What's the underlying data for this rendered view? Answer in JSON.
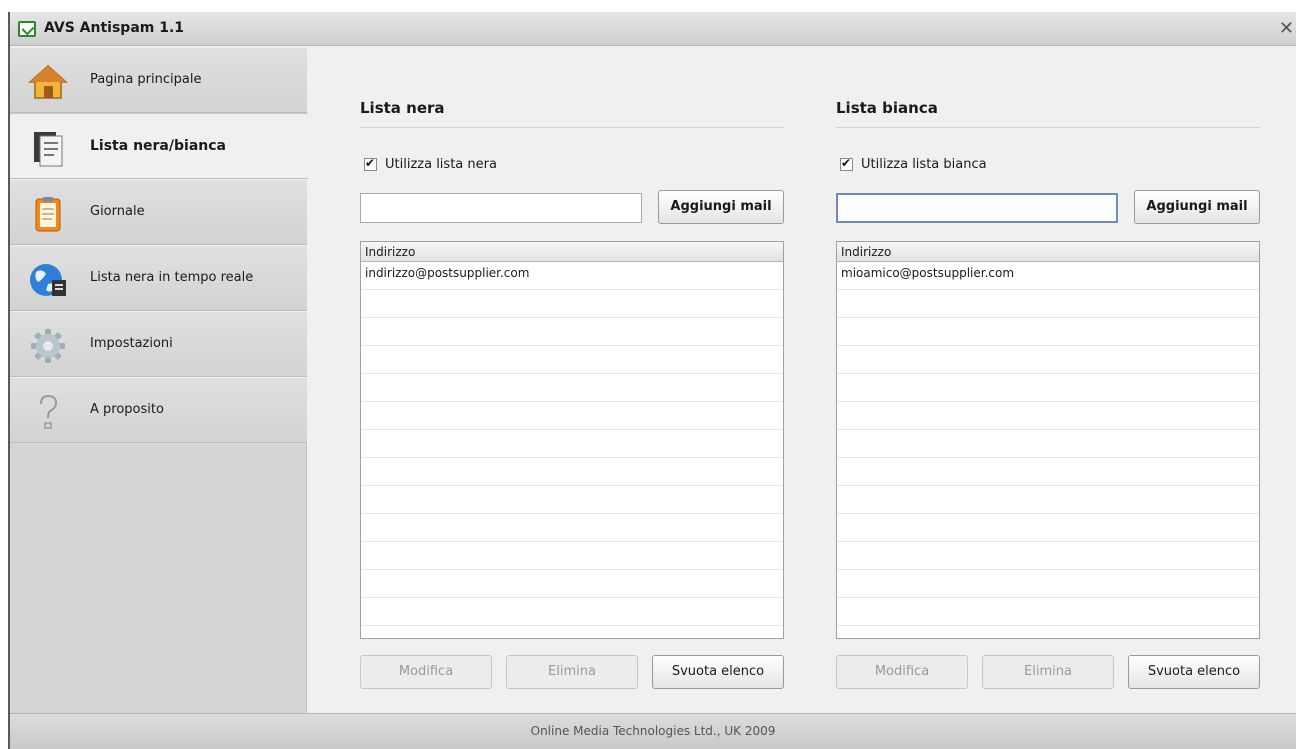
{
  "window": {
    "title": "AVS Antispam 1.1",
    "close_glyph": "✕"
  },
  "sidebar": {
    "items": [
      {
        "label": "Pagina principale",
        "icon": "home-icon"
      },
      {
        "label": "Lista nera/bianca",
        "icon": "document-list-icon"
      },
      {
        "label": "Giornale",
        "icon": "clipboard-icon"
      },
      {
        "label": "Lista nera in tempo reale",
        "icon": "globe-icon"
      },
      {
        "label": "Impostazioni",
        "icon": "gear-icon"
      },
      {
        "label": "A proposito",
        "icon": "question-icon"
      }
    ],
    "active_index": 1
  },
  "blacklist": {
    "title": "Lista nera",
    "checkbox_label": "Utilizza lista nera",
    "checked": true,
    "input_value": "",
    "add_button": "Aggiungi mail",
    "column_header": "Indirizzo",
    "rows": [
      "indirizzo@postsupplier.com"
    ],
    "edit_button": "Modifica",
    "delete_button": "Elimina",
    "clear_button": "Svuota elenco"
  },
  "whitelist": {
    "title": "Lista bianca",
    "checkbox_label": "Utilizza lista bianca",
    "checked": true,
    "input_value": "",
    "add_button": "Aggiungi mail",
    "column_header": "Indirizzo",
    "rows": [
      "mioamico@postsupplier.com"
    ],
    "edit_button": "Modifica",
    "delete_button": "Elimina",
    "clear_button": "Svuota elenco"
  },
  "status": {
    "text": "Online Media Technologies Ltd., UK 2009"
  },
  "colors": {
    "brand_green": "#2a8a2a",
    "focus_border": "#6f8bb8"
  }
}
